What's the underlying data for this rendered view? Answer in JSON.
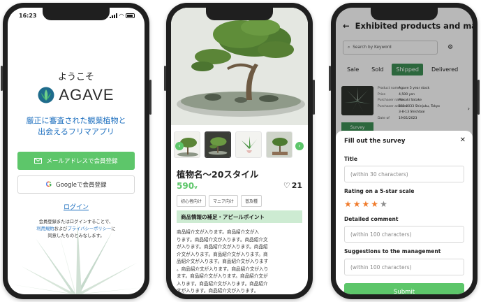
{
  "status_bar": {
    "time": "16:23"
  },
  "login": {
    "welcome": "ようこそ",
    "brand": "AGAVE",
    "tagline_line1": "厳正に審査された観葉植物と",
    "tagline_line2": "出会えるフリマアプリ",
    "email_button": "メールアドレスで会員登録",
    "google_button": "Googleで会員登録",
    "login_link": "ログイン",
    "terms_line1": "会員登録またはログインすることで、",
    "terms_link1": "利用規約",
    "terms_and": "および",
    "terms_link2": "プライバシーポリシー",
    "terms_suffix": "に",
    "terms_line3": "同意したものとみなします。"
  },
  "product": {
    "title": "植物名〜20スタイル",
    "price": "590",
    "price_unit": "v",
    "likes": "21",
    "tags": [
      "初心者向け",
      "マニア向け",
      "普及種"
    ],
    "section_header": "商品情報の補足・アピールポイント",
    "description_lines": [
      "商品紹介文が入ります。商品紹介文が入",
      "ります。商品紹介文が入ります。商品紹介文",
      "が入ります。商品紹介文が入ります。商品紹",
      "介文が入ります。商品紹介文が入ります。商",
      "品紹介文が入ります。商品紹介文が入ります",
      "。商品紹介文が入ります。商品紹介文が入り",
      "ます。商品紹介文が入ります。商品紹介文が",
      "入ります。商品紹介文が入ります。商品紹介",
      "文が入ります。商品紹介文が入ります。"
    ]
  },
  "exhibited": {
    "title": "Exhibited products and manage",
    "search_placeholder": "Search by Keyword",
    "tabs": [
      "Sale",
      "Sold",
      "Shipped",
      "Delivered"
    ],
    "active_tab": "Shipped",
    "card": {
      "rows": [
        {
          "k": "Product name",
          "v": "Agave 5 year stock"
        },
        {
          "k": "Price",
          "v": "4,500 yen"
        },
        {
          "k": "Purchaser name",
          "v": "Masaki Satake"
        },
        {
          "k": "Purchaser address",
          "v": "161-0033 Shinjuku, Tokyo"
        },
        {
          "k": "",
          "v": "3-8-13 Shishtaai"
        },
        {
          "k": "Date of",
          "v": "19/01/2023"
        }
      ],
      "survey_button": "Survey"
    },
    "survey": {
      "heading": "Fill out the survey",
      "title_label": "Title",
      "title_placeholder": "(within 30 characters)",
      "rating_label": "Rating on a 5-star scale",
      "rating": 4,
      "rating_max": 5,
      "comment_label": "Detailed comment",
      "comment_placeholder": "(within 100 characters)",
      "suggestion_label": "Suggestions to the management",
      "suggestion_placeholder": "(within 100 characters)",
      "submit": "Submit"
    }
  },
  "colors": {
    "accent_green": "#5dc66a",
    "dark_green": "#3e8f55",
    "link_blue": "#1d6fbf",
    "star_orange": "#f07a2a"
  }
}
